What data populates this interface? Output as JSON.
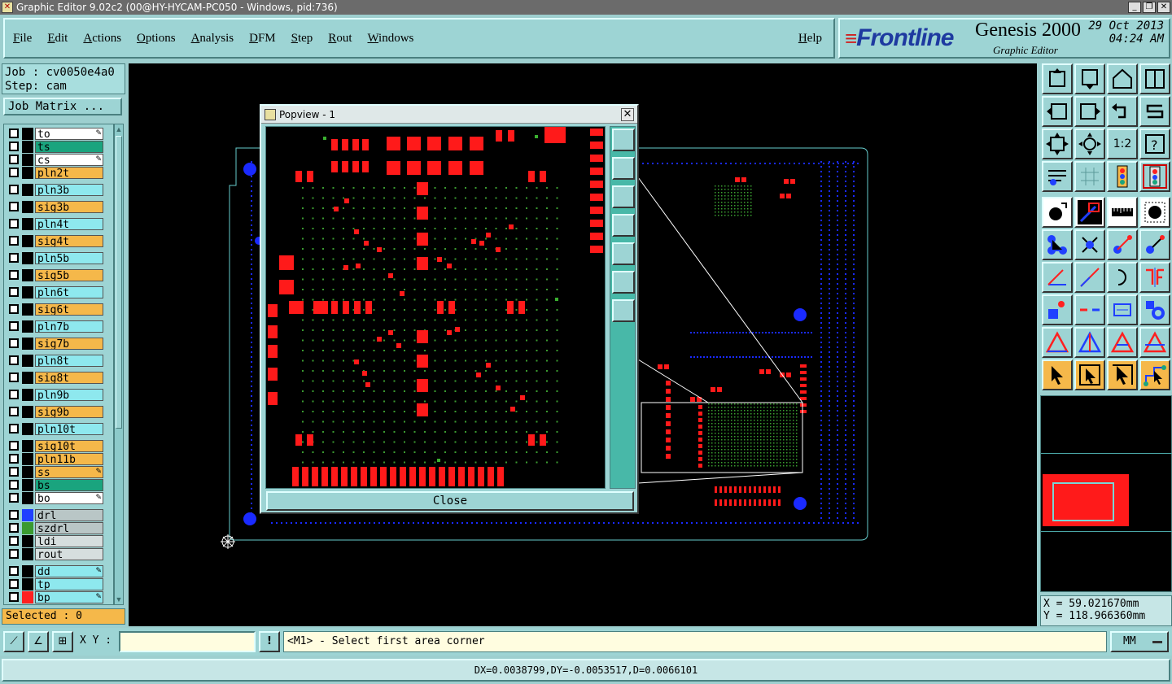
{
  "window": {
    "title": "Graphic Editor 9.02c2 (00@HY-HYCAM-PC050 - Windows, pid:736)"
  },
  "menu": [
    "File",
    "Edit",
    "Actions",
    "Options",
    "Analysis",
    "DFM",
    "Step",
    "Rout",
    "Windows"
  ],
  "help": "Help",
  "brand": {
    "logo": "Frontline",
    "product": "Genesis 2000",
    "subtitle": "Graphic Editor",
    "date": "29 Oct 2013",
    "time": "04:24 AM"
  },
  "job": {
    "job": "Job : cv0050e4a0",
    "step": "Step: cam",
    "matrix_button": "Job Matrix ..."
  },
  "layers": [
    {
      "name": "to",
      "color": "white",
      "swatch": "#000000",
      "act": true
    },
    {
      "name": "ts",
      "color": "green",
      "swatch": "#000000",
      "act": false
    },
    {
      "name": "cs",
      "color": "white",
      "swatch": "#000000",
      "act": true
    },
    {
      "name": "pln2t",
      "color": "orange",
      "swatch": "#000000",
      "act": false
    },
    {
      "name": "pln3b",
      "color": "cyan",
      "swatch": "#000000",
      "act": false
    },
    {
      "name": "sig3b",
      "color": "orange",
      "swatch": "#000000",
      "act": false
    },
    {
      "name": "pln4t",
      "color": "cyan",
      "swatch": "#000000",
      "act": false
    },
    {
      "name": "sig4t",
      "color": "orange",
      "swatch": "#000000",
      "act": false
    },
    {
      "name": "pln5b",
      "color": "cyan",
      "swatch": "#000000",
      "act": false
    },
    {
      "name": "sig5b",
      "color": "orange",
      "swatch": "#000000",
      "act": false
    },
    {
      "name": "pln6t",
      "color": "cyan",
      "swatch": "#000000",
      "act": false
    },
    {
      "name": "sig6t",
      "color": "orange",
      "swatch": "#000000",
      "act": false
    },
    {
      "name": "pln7b",
      "color": "cyan",
      "swatch": "#000000",
      "act": false
    },
    {
      "name": "sig7b",
      "color": "orange",
      "swatch": "#000000",
      "act": false
    },
    {
      "name": "pln8t",
      "color": "cyan",
      "swatch": "#000000",
      "act": false
    },
    {
      "name": "sig8t",
      "color": "orange",
      "swatch": "#000000",
      "act": false
    },
    {
      "name": "pln9b",
      "color": "cyan",
      "swatch": "#000000",
      "act": false
    },
    {
      "name": "sig9b",
      "color": "orange",
      "swatch": "#000000",
      "act": false
    },
    {
      "name": "pln10t",
      "color": "cyan",
      "swatch": "#000000",
      "act": false
    },
    {
      "name": "sig10t",
      "color": "orange",
      "swatch": "#000000",
      "act": false
    },
    {
      "name": "pln11b",
      "color": "orange",
      "swatch": "#000000",
      "act": false
    },
    {
      "name": "ss",
      "color": "orange",
      "swatch": "#000000",
      "act": true
    },
    {
      "name": "bs",
      "color": "green",
      "swatch": "#000000",
      "act": false
    },
    {
      "name": "bo",
      "color": "white",
      "swatch": "#000000",
      "act": true
    },
    {
      "name": "drl",
      "color": "gray",
      "swatch": "#2040ff",
      "act": false
    },
    {
      "name": "szdrl",
      "color": "gray",
      "swatch": "#3a9a30",
      "act": false
    },
    {
      "name": "ldi",
      "color": "lgray",
      "swatch": "#000000",
      "act": false
    },
    {
      "name": "rout",
      "color": "lgray",
      "swatch": "#000000",
      "act": false
    },
    {
      "name": "dd",
      "color": "cyan",
      "swatch": "#000000",
      "act": true
    },
    {
      "name": "tp",
      "color": "cyan",
      "swatch": "#000000",
      "act": false
    },
    {
      "name": "bp",
      "color": "cyan",
      "swatch": "#ff2020",
      "act": true
    }
  ],
  "selected": "Selected : 0",
  "popview": {
    "title": "Popview - 1",
    "close_label": "Close"
  },
  "coords": {
    "x": "X  =  59.021670mm",
    "y": "Y  = 118.966360mm"
  },
  "bottom": {
    "xy_label": "X Y :",
    "xy_value": "",
    "prompt": "<M1> - Select first area corner",
    "units": "MM"
  },
  "status": "DX=0.0038799,DY=-0.0053517,D=0.0066101",
  "colors": {
    "panel": "#9dd4d4",
    "copper": "#ff1a1a",
    "drill": "#1a2aff",
    "outline": "#66cccc"
  }
}
